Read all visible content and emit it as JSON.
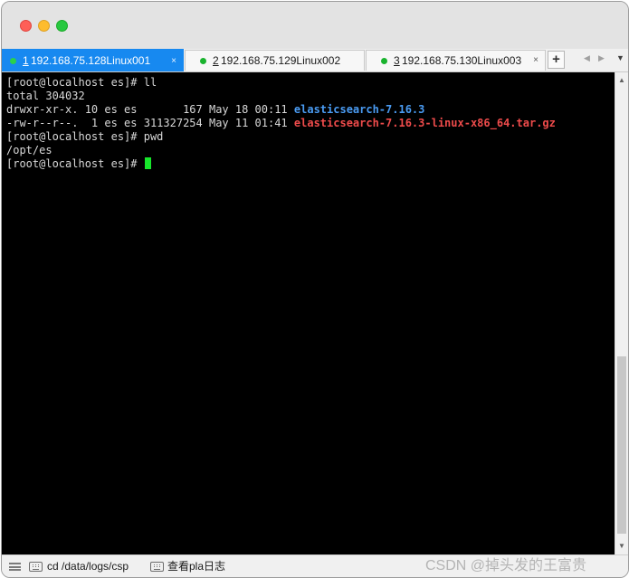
{
  "window": {
    "traffic_lights": {
      "close_color": "#fe5f57",
      "minimize_color": "#febc2e",
      "zoom_color": "#28c840"
    }
  },
  "tabs": [
    {
      "number": "1",
      "label": "192.168.75.128Linux001",
      "active": true,
      "status_color": "#2bd14b"
    },
    {
      "number": "2",
      "label": "192.168.75.129Linux002",
      "active": false,
      "status_color": "#19b32e"
    },
    {
      "number": "3",
      "label": "192.168.75.130Linux003",
      "active": false,
      "status_color": "#19b32e"
    }
  ],
  "tabbar": {
    "close_glyph": "×",
    "new_tab_glyph": "+",
    "prev_glyph": "◀",
    "next_glyph": "▶",
    "menu_glyph": "▼",
    "active_color": "#1789f0"
  },
  "terminal": {
    "lines": [
      {
        "prompt": "[root@localhost es]# ",
        "cmd": "ll"
      },
      {
        "text": "total 304032"
      },
      {
        "meta": "drwxr-xr-x. 10 es es       167 May 18 00:11 ",
        "name": "elasticsearch-7.16.3",
        "kind": "directory"
      },
      {
        "meta": "-rw-r--r--.  1 es es 311327254 May 11 01:41 ",
        "name": "elasticsearch-7.16.3-linux-x86_64.tar.gz",
        "kind": "archive"
      },
      {
        "prompt": "[root@localhost es]# ",
        "cmd": "pwd"
      },
      {
        "text": "/opt/es"
      },
      {
        "prompt": "[root@localhost es]# ",
        "cmd": ""
      }
    ],
    "colors": {
      "background": "#000000",
      "text": "#d8d8d8",
      "directory": "#4a9bf2",
      "archive": "#ee4b4b",
      "cursor": "#17e62b"
    }
  },
  "scrollbar": {
    "up_glyph": "▲",
    "down_glyph": "▼"
  },
  "statusbar": {
    "quick_commands": [
      {
        "icon": "keyboard-icon",
        "label": "cd /data/logs/csp"
      },
      {
        "icon": "keyboard-icon",
        "label": "查看pla日志"
      }
    ],
    "watermark": "CSDN @掉头发的王富贵"
  }
}
